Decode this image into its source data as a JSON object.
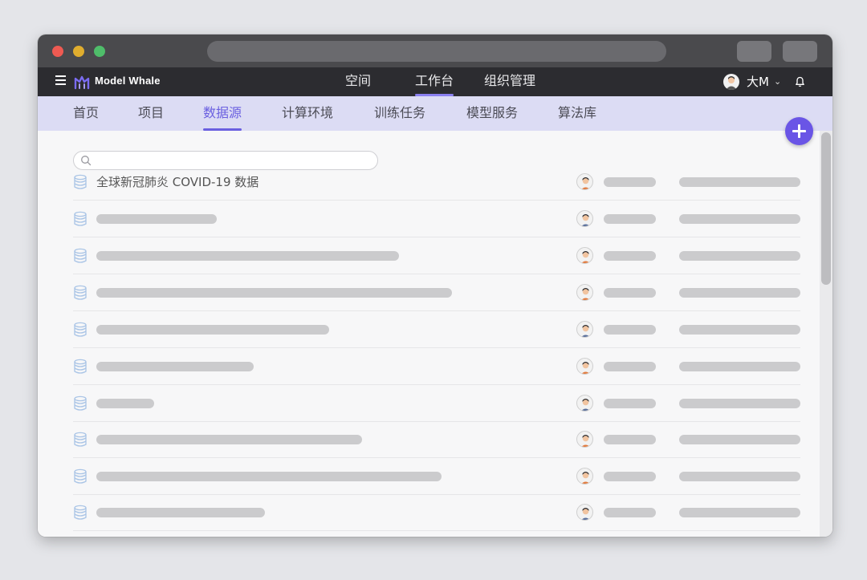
{
  "app": {
    "name": "Model Whale"
  },
  "top_nav": [
    {
      "label": "空间",
      "active": false
    },
    {
      "label": "工作台",
      "active": true
    },
    {
      "label": "组织管理",
      "active": false
    }
  ],
  "user": {
    "name": "大M"
  },
  "sub_tabs": [
    {
      "label": "首页",
      "active": false
    },
    {
      "label": "项目",
      "active": false
    },
    {
      "label": "数据源",
      "active": true
    },
    {
      "label": "计算环境",
      "active": false
    },
    {
      "label": "训练任务",
      "active": false
    },
    {
      "label": "模型服务",
      "active": false
    },
    {
      "label": "算法库",
      "active": false
    }
  ],
  "search": {
    "placeholder": "",
    "value": ""
  },
  "datasets": [
    {
      "name": "全球新冠肺炎 COVID-19 数据",
      "avatar": "avatar-orange"
    },
    {
      "name": "",
      "avatar": "avatar-blue"
    },
    {
      "name": "",
      "avatar": "avatar-orange"
    },
    {
      "name": "",
      "avatar": "avatar-orange"
    },
    {
      "name": "",
      "avatar": "avatar-blue"
    },
    {
      "name": "",
      "avatar": "avatar-orange"
    },
    {
      "name": "",
      "avatar": "avatar-blue"
    },
    {
      "name": "",
      "avatar": "avatar-orange"
    },
    {
      "name": "",
      "avatar": "avatar-orange"
    },
    {
      "name": "",
      "avatar": "avatar-blue"
    }
  ],
  "colors": {
    "accent": "#6a5fe0",
    "fab": "#6a55e6",
    "header_bg": "#2c2c30",
    "subbar_bg": "#dcdcf4",
    "placeholder_bar": "#cbcbcd"
  },
  "icons": {
    "menu": "hamburger-icon",
    "logo": "model-whale-logo",
    "notification": "bell-icon",
    "add": "plus-icon",
    "search": "search-icon",
    "dataset": "database-icon"
  }
}
